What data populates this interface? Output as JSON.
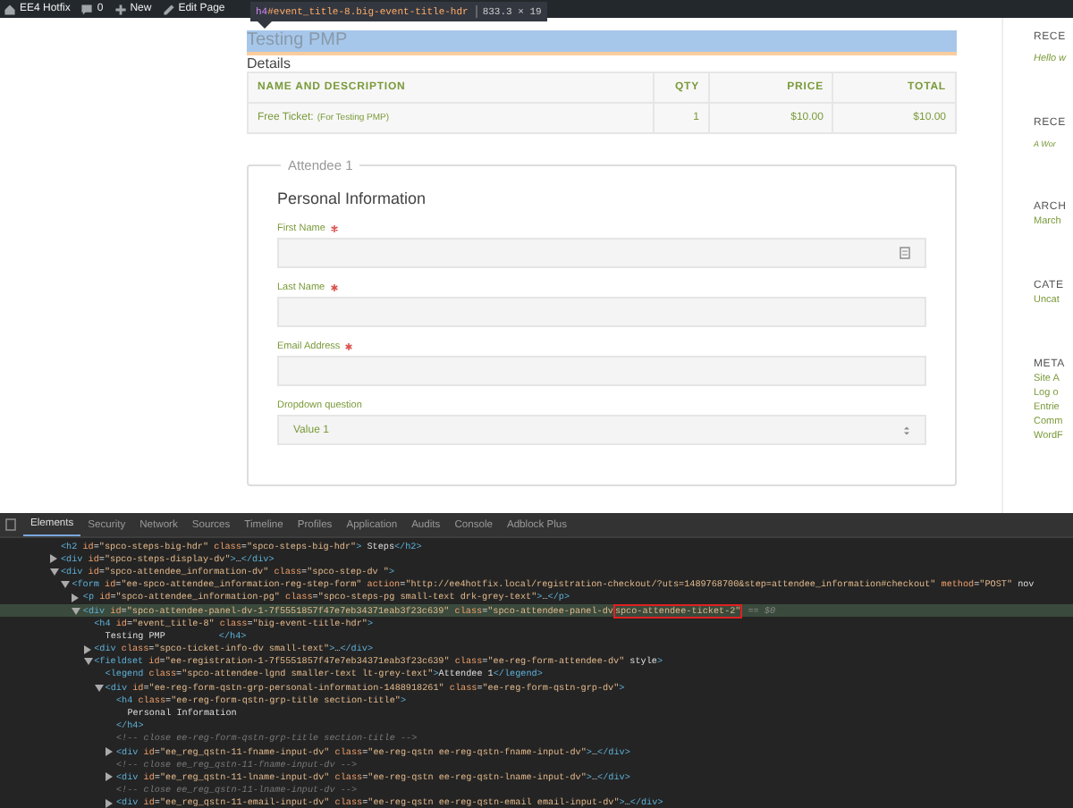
{
  "admin_bar": {
    "items": [
      {
        "kind": "site",
        "label": "EE4 Hotfix"
      },
      {
        "kind": "comments",
        "label": "0"
      },
      {
        "kind": "new",
        "label": "New"
      },
      {
        "kind": "edit",
        "label": "Edit Page"
      }
    ]
  },
  "inspect_tooltip": {
    "tag": "h4",
    "selector": "#event_title-8.big-event-title-hdr",
    "size": "833.3 × 19"
  },
  "event": {
    "title": "Testing PMP",
    "title_highlighted": true,
    "details_label": "Details",
    "table": {
      "columns": [
        "NAME AND DESCRIPTION",
        "QTY",
        "PRICE",
        "TOTAL"
      ],
      "rows": [
        {
          "name": "Free Ticket:",
          "note": "(For Testing PMP)",
          "qty": "1",
          "price": "$10.00",
          "total": "$10.00"
        }
      ]
    }
  },
  "attendee": {
    "legend": "Attendee 1",
    "section_title": "Personal Information",
    "fields": [
      {
        "kind": "text",
        "label": "First Name",
        "required": true,
        "autofill_icon": true
      },
      {
        "kind": "text",
        "label": "Last Name",
        "required": true,
        "autofill_icon": false
      },
      {
        "kind": "text",
        "label": "Email Address",
        "required": true,
        "autofill_icon": false
      },
      {
        "kind": "select",
        "label": "Dropdown question",
        "required": false,
        "value": "Value 1"
      }
    ]
  },
  "sidebar": [
    {
      "kind": "heading",
      "text": "RECE"
    },
    {
      "kind": "quote",
      "text": "Hello w"
    },
    {
      "kind": "heading",
      "text": "RECE"
    },
    {
      "kind": "small",
      "text": "A Wor"
    },
    {
      "kind": "heading",
      "text": "ARCH"
    },
    {
      "kind": "link",
      "text": "March"
    },
    {
      "kind": "heading",
      "text": "CATE"
    },
    {
      "kind": "link",
      "text": "Uncat"
    },
    {
      "kind": "heading",
      "text": "META"
    },
    {
      "kind": "link",
      "text": "Site A"
    },
    {
      "kind": "link",
      "text": "Log o"
    },
    {
      "kind": "link",
      "text": "Entrie"
    },
    {
      "kind": "link",
      "text": "Comm"
    },
    {
      "kind": "link",
      "text": "WordF"
    }
  ],
  "devtools": {
    "tabs": [
      {
        "label": "Elements",
        "selected": true
      },
      {
        "label": "Security",
        "selected": false
      },
      {
        "label": "Network",
        "selected": false
      },
      {
        "label": "Sources",
        "selected": false
      },
      {
        "label": "Timeline",
        "selected": false
      },
      {
        "label": "Profiles",
        "selected": false
      },
      {
        "label": "Application",
        "selected": false
      },
      {
        "label": "Audits",
        "selected": false
      },
      {
        "label": "Console",
        "selected": false
      },
      {
        "label": "Adblock Plus",
        "selected": false
      }
    ],
    "tree": [
      {
        "kind": "element",
        "text": "<h2 id=\"spco-steps-big-hdr\" class=\"spco-steps-big-hdr\"> Steps</h2>",
        "selected": false
      },
      {
        "kind": "element",
        "text": "<div id=\"spco-steps-display-dv\">…</div>",
        "selected": false,
        "expanded": false
      },
      {
        "kind": "element",
        "text": "<div id=\"spco-attendee_information-dv\" class=\"spco-step-dv \">",
        "selected": false,
        "expanded": true,
        "children": [
          {
            "kind": "element",
            "text": "<form id=\"ee-spco-attendee_information-reg-step-form\" action=\"http://ee4hotfix.local/registration-checkout/?uts=1489768700&step=attendee_information#checkout\" method=\"POST\" nov",
            "selected": false,
            "expanded": true,
            "children": [
              {
                "kind": "element",
                "text": "<p id=\"spco-attendee_information-pg\" class=\"spco-steps-pg small-text drk-grey-text\">…</p>",
                "selected": false,
                "expanded": false
              },
              {
                "kind": "element",
                "text": "<div id=\"spco-attendee-panel-dv-1-7f5551857f47e7eb34371eab3f23c639\" class=\"spco-attendee-panel-dv ",
                "outlined": "spco-attendee-ticket-2\"",
                "after": "== $0",
                "selected": true,
                "expanded": true,
                "children": [
                  {
                    "kind": "element",
                    "text": "<h4 id=\"event_title-8\" class=\"big-event-title-hdr\">",
                    "selected": false,
                    "children": [
                      {
                        "kind": "text",
                        "text": "Testing PMP",
                        "tail": "</h4>",
                        "selected": false
                      }
                    ]
                  },
                  {
                    "kind": "element",
                    "text": "<div class=\"spco-ticket-info-dv small-text\">…</div>",
                    "selected": false,
                    "expanded": false
                  },
                  {
                    "kind": "element",
                    "text": "<fieldset id=\"ee-registration-1-7f5551857f47e7eb34371eab3f23c639\" class=\"ee-reg-form-attendee-dv\" style>",
                    "selected": false,
                    "expanded": true,
                    "children": [
                      {
                        "kind": "element",
                        "text": "<legend class=\"spco-attendee-lgnd smaller-text lt-grey-text\">Attendee 1</legend>",
                        "selected": false
                      },
                      {
                        "kind": "element",
                        "text": "<div id=\"ee-reg-form-qstn-grp-personal-information-1488918261\" class=\"ee-reg-form-qstn-grp-dv\">",
                        "selected": false,
                        "expanded": true,
                        "children": [
                          {
                            "kind": "element",
                            "text": "<h4 class=\"ee-reg-form-qstn-grp-title section-title\">",
                            "closing": "</h4>",
                            "selected": false,
                            "children": [
                              {
                                "kind": "text",
                                "text": "Personal Information",
                                "selected": false
                              }
                            ]
                          },
                          {
                            "kind": "comment",
                            "text": "<!-- close ee-reg-form-qstn-grp-title section-title -->",
                            "selected": false
                          },
                          {
                            "kind": "element",
                            "text": "<div id=\"ee_reg_qstn-11-fname-input-dv\" class=\"ee-reg-qstn ee-reg-qstn-fname-input-dv\">…</div>",
                            "selected": false,
                            "expanded": false
                          },
                          {
                            "kind": "comment",
                            "text": "<!-- close ee_reg_qstn-11-fname-input-dv -->",
                            "selected": false
                          },
                          {
                            "kind": "element",
                            "text": "<div id=\"ee_reg_qstn-11-lname-input-dv\" class=\"ee-reg-qstn ee-reg-qstn-lname-input-dv\">…</div>",
                            "selected": false,
                            "expanded": false
                          },
                          {
                            "kind": "comment",
                            "text": "<!-- close ee_reg_qstn-11-lname-input-dv -->",
                            "selected": false
                          },
                          {
                            "kind": "element",
                            "text": "<div id=\"ee_reg_qstn-11-email-input-dv\" class=\"ee-reg-qstn ee-reg-qstn-email email-input-dv\">…</div>",
                            "selected": false,
                            "expanded": false
                          }
                        ]
                      }
                    ]
                  }
                ]
              }
            ]
          }
        ]
      }
    ]
  }
}
